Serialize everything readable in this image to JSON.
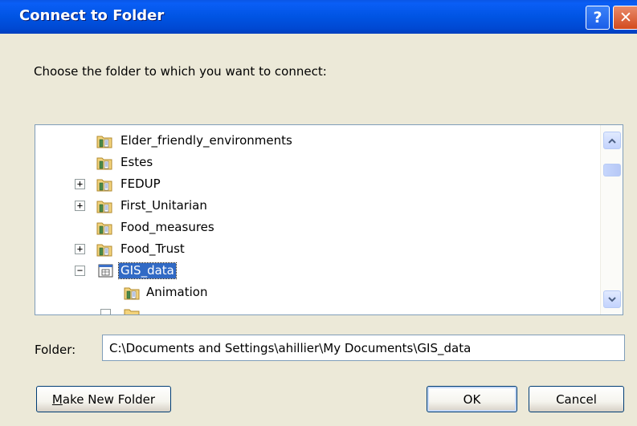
{
  "window": {
    "title": "Connect to Folder",
    "help_glyph": "?",
    "close_glyph": "✕"
  },
  "instruction": "Choose the folder to which you want to connect:",
  "tree": {
    "items": [
      {
        "label": "Elder_friendly_environments",
        "expander": "",
        "icon": "folder-icon",
        "selected": false
      },
      {
        "label": "Estes",
        "expander": "",
        "icon": "folder-icon",
        "selected": false
      },
      {
        "label": "FEDUP",
        "expander": "+",
        "icon": "folder-icon",
        "selected": false
      },
      {
        "label": "First_Unitarian",
        "expander": "+",
        "icon": "folder-icon",
        "selected": false
      },
      {
        "label": "Food_measures",
        "expander": "",
        "icon": "folder-icon",
        "selected": false
      },
      {
        "label": "Food_Trust",
        "expander": "+",
        "icon": "folder-icon",
        "selected": false
      },
      {
        "label": "GIS_data",
        "expander": "−",
        "icon": "database-folder-icon",
        "selected": true
      },
      {
        "label": "Animation",
        "expander": "",
        "icon": "folder-icon",
        "selected": false
      }
    ]
  },
  "folder": {
    "label": "Folder:",
    "value": "C:\\Documents and Settings\\ahillier\\My Documents\\GIS_data"
  },
  "buttons": {
    "make_new_folder_prefix": "M",
    "make_new_folder_rest": "ake New Folder",
    "ok": "OK",
    "cancel": "Cancel"
  },
  "colors": {
    "titlebar": "#0054e3",
    "selection": "#316ac5",
    "dialog_bg": "#ece9d8"
  }
}
